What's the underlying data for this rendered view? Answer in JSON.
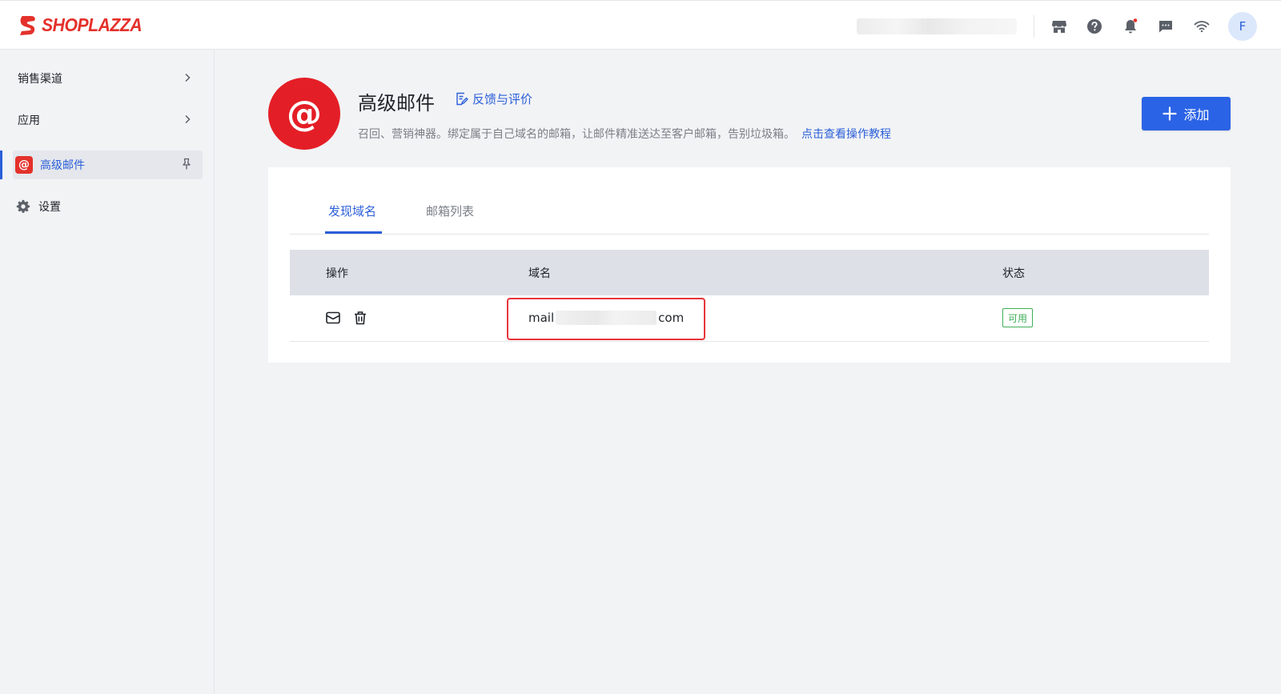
{
  "brand": {
    "name": "SHOPLAZZA",
    "color": "#e4312b"
  },
  "topbar": {
    "icons": [
      "store-icon",
      "help-icon",
      "bell-icon",
      "message-icon",
      "wifi-icon"
    ],
    "avatar_initial": "F"
  },
  "sidebar": {
    "items": [
      {
        "label": "销售渠道",
        "has_chevron": true
      },
      {
        "label": "应用",
        "has_chevron": true
      },
      {
        "label": "高级邮件",
        "active": true,
        "badge": "@"
      },
      {
        "label": "设置"
      }
    ]
  },
  "app": {
    "logo_symbol": "@",
    "title": "高级邮件",
    "feedback_label": "反馈与评价",
    "description": "召回、营销神器。绑定属于自己域名的邮箱，让邮件精准送达至客户邮箱，告别垃圾箱。",
    "tutorial_link": "点击查看操作教程",
    "add_button": "添加",
    "accent_color": "#2b5fd9"
  },
  "tabs": [
    {
      "label": "发现域名",
      "active": true
    },
    {
      "label": "邮箱列表",
      "active": false
    }
  ],
  "table": {
    "columns": [
      "操作",
      "域名",
      "状态"
    ],
    "rows": [
      {
        "actions": [
          "mail-icon",
          "trash-icon"
        ],
        "domain_prefix": "mail",
        "domain_suffix": "com",
        "status": "可用",
        "status_color": "#3fae57"
      }
    ]
  }
}
